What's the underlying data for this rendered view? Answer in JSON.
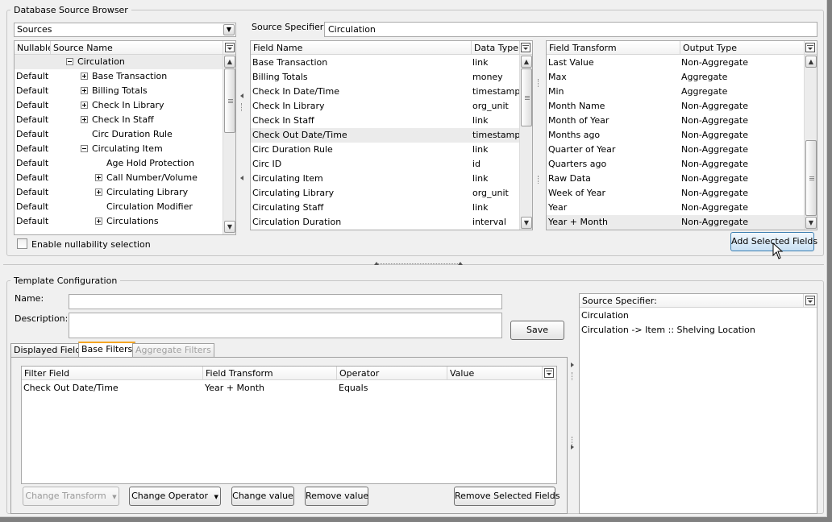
{
  "browser": {
    "title": "Database Source Browser",
    "sources_combo": "Sources",
    "tree_headers": {
      "nullable": "Nullable",
      "source_name": "Source Name"
    },
    "tree_rows": [
      {
        "nullable": "",
        "name": "Circulation",
        "level": 0,
        "expander": "minus",
        "selected": true
      },
      {
        "nullable": "Default",
        "name": "Base Transaction",
        "level": 1,
        "expander": "plus"
      },
      {
        "nullable": "Default",
        "name": "Billing Totals",
        "level": 1,
        "expander": "plus"
      },
      {
        "nullable": "Default",
        "name": "Check In Library",
        "level": 1,
        "expander": "plus"
      },
      {
        "nullable": "Default",
        "name": "Check In Staff",
        "level": 1,
        "expander": "plus"
      },
      {
        "nullable": "Default",
        "name": "Circ Duration Rule",
        "level": 1,
        "expander": "none"
      },
      {
        "nullable": "Default",
        "name": "Circulating Item",
        "level": 1,
        "expander": "minus"
      },
      {
        "nullable": "Default",
        "name": "Age Hold Protection",
        "level": 2,
        "expander": "none"
      },
      {
        "nullable": "Default",
        "name": "Call Number/Volume",
        "level": 2,
        "expander": "plus"
      },
      {
        "nullable": "Default",
        "name": "Circulating Library",
        "level": 2,
        "expander": "plus"
      },
      {
        "nullable": "Default",
        "name": "Circulation Modifier",
        "level": 2,
        "expander": "none"
      },
      {
        "nullable": "Default",
        "name": "Circulations",
        "level": 2,
        "expander": "plus"
      }
    ],
    "nullability_label": "Enable nullability selection",
    "source_specifier_label": "Source Specifier:",
    "source_specifier_value": "Circulation",
    "field_headers": {
      "field_name": "Field Name",
      "data_type": "Data Type"
    },
    "field_rows": [
      {
        "name": "Base Transaction",
        "type": "link"
      },
      {
        "name": "Billing Totals",
        "type": "money"
      },
      {
        "name": "Check In Date/Time",
        "type": "timestamp"
      },
      {
        "name": "Check In Library",
        "type": "org_unit"
      },
      {
        "name": "Check In Staff",
        "type": "link"
      },
      {
        "name": "Check Out Date/Time",
        "type": "timestamp",
        "selected": true
      },
      {
        "name": "Circ Duration Rule",
        "type": "link"
      },
      {
        "name": "Circ ID",
        "type": "id"
      },
      {
        "name": "Circulating Item",
        "type": "link"
      },
      {
        "name": "Circulating Library",
        "type": "org_unit"
      },
      {
        "name": "Circulating Staff",
        "type": "link"
      },
      {
        "name": "Circulation Duration",
        "type": "interval"
      }
    ],
    "transform_headers": {
      "transform": "Field Transform",
      "output": "Output Type"
    },
    "transform_rows": [
      {
        "name": "Last Value",
        "output": "Non-Aggregate"
      },
      {
        "name": "Max",
        "output": "Aggregate"
      },
      {
        "name": "Min",
        "output": "Aggregate"
      },
      {
        "name": "Month Name",
        "output": "Non-Aggregate"
      },
      {
        "name": "Month of Year",
        "output": "Non-Aggregate"
      },
      {
        "name": "Months ago",
        "output": "Non-Aggregate"
      },
      {
        "name": "Quarter of Year",
        "output": "Non-Aggregate"
      },
      {
        "name": "Quarters ago",
        "output": "Non-Aggregate"
      },
      {
        "name": "Raw Data",
        "output": "Non-Aggregate"
      },
      {
        "name": "Week of Year",
        "output": "Non-Aggregate"
      },
      {
        "name": "Year",
        "output": "Non-Aggregate"
      },
      {
        "name": "Year + Month",
        "output": "Non-Aggregate",
        "selected": true
      }
    ],
    "add_selected_label": "Add Selected Fields"
  },
  "template": {
    "title": "Template Configuration",
    "name_label": "Name:",
    "name_value": "",
    "description_label": "Description:",
    "description_value": "",
    "save_label": "Save",
    "tabs": [
      {
        "label": "Displayed Fields",
        "state": "normal"
      },
      {
        "label": "Base Filters",
        "state": "active"
      },
      {
        "label": "Aggregate Filters",
        "state": "disabled"
      }
    ],
    "filter_headers": {
      "field": "Filter Field",
      "transform": "Field Transform",
      "operator": "Operator",
      "value": "Value"
    },
    "filter_rows": [
      {
        "field": "Check Out Date/Time",
        "transform": "Year + Month",
        "operator": "Equals",
        "value": ""
      }
    ],
    "buttons": {
      "change_transform": "Change Transform",
      "change_operator": "Change Operator",
      "change_value": "Change value",
      "remove_value": "Remove value",
      "remove_selected": "Remove Selected Fields"
    },
    "specifier_header": "Source Specifier:",
    "specifier_rows": [
      "Circulation",
      "Circulation -> Item :: Shelving Location"
    ]
  }
}
